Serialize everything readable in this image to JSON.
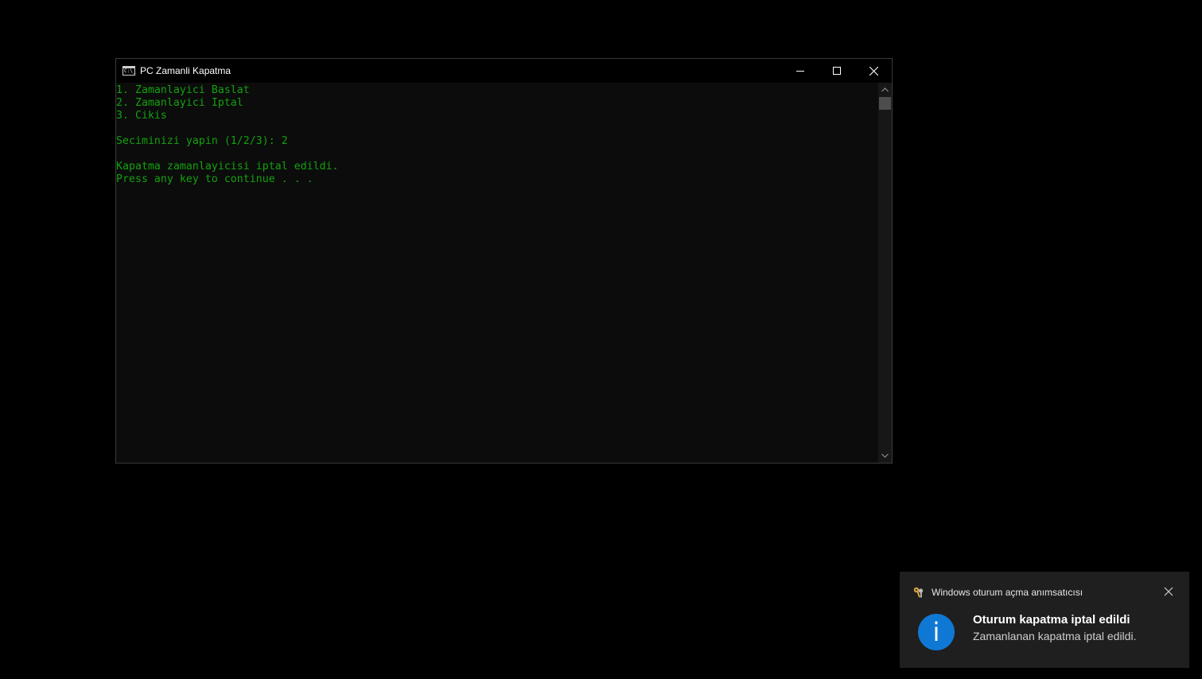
{
  "window": {
    "title": "PC Zamanli Kapatma",
    "icon_name": "console-icon",
    "icon_text": "C:\\_",
    "controls": [
      "minimize-icon",
      "maximize-icon",
      "close-icon"
    ]
  },
  "console": {
    "text_color": "#13a10e",
    "background": "#0c0c0c",
    "lines": [
      "1. Zamanlayici Baslat",
      "2. Zamanlayici Iptal",
      "3. Cikis",
      "",
      "Seciminizi yapin (1/2/3): 2",
      "",
      "Kapatma zamanlayicisi iptal edildi.",
      "Press any key to continue . . ."
    ]
  },
  "notification": {
    "app_name": "Windows oturum açma anımsatıcısı",
    "app_icon": "keys-icon",
    "title": "Oturum kapatma iptal edildi",
    "message": "Zamanlanan kapatma iptal edildi.",
    "icon": "info-icon",
    "icon_glyph": "i",
    "accent_color": "#0f78d4"
  }
}
